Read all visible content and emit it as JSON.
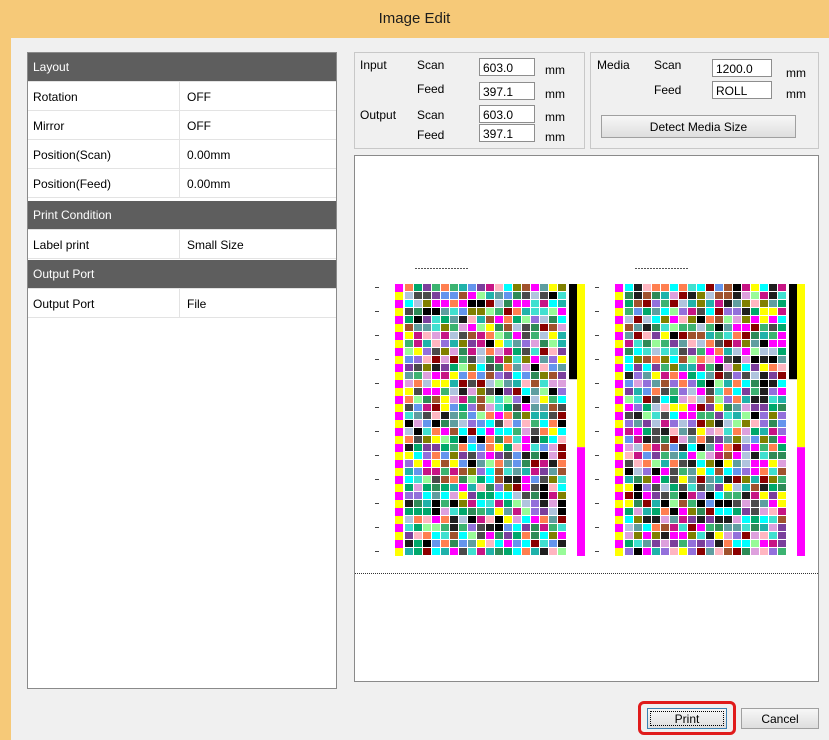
{
  "window": {
    "title": "Image Edit"
  },
  "properties": {
    "sections": [
      {
        "header": "Layout",
        "rows": [
          {
            "key": "Rotation",
            "value": "OFF"
          },
          {
            "key": "Mirror",
            "value": "OFF"
          },
          {
            "key": "Position(Scan)",
            "value": "0.00mm"
          },
          {
            "key": "Position(Feed)",
            "value": "0.00mm"
          }
        ]
      },
      {
        "header": "Print Condition",
        "rows": [
          {
            "key": "Label print",
            "value": "Small Size"
          }
        ]
      },
      {
        "header": "Output Port",
        "rows": [
          {
            "key": "Output Port",
            "value": "File"
          }
        ]
      }
    ]
  },
  "sizes": {
    "input_label": "Input",
    "output_label": "Output",
    "scan_label": "Scan",
    "feed_label": "Feed",
    "unit": "mm",
    "input_scan": "603.0",
    "input_feed": "397.1",
    "output_scan": "603.0",
    "output_feed": "397.1"
  },
  "media": {
    "label": "Media",
    "scan_label": "Scan",
    "feed_label": "Feed",
    "scan_value": "1200.0",
    "feed_value": "ROLL",
    "unit": "mm",
    "detect_button": "Detect Media Size"
  },
  "footer": {
    "print_button": "Print",
    "cancel_button": "Cancel"
  },
  "colors": {
    "title_bar": "#f6c978",
    "section_header": "#5e5e5e",
    "highlight": "#e01b1b",
    "patch_palette": [
      "#ff00ff",
      "#ffff00",
      "#00ffff",
      "#000000",
      "#1e1e1e",
      "#4a4a4a",
      "#7b3f9c",
      "#2e8b57",
      "#c71585",
      "#6495ed",
      "#00a86b",
      "#ff7f50",
      "#a0522d",
      "#b0c4de",
      "#98fb98",
      "#dda0dd",
      "#40e0d0",
      "#808000",
      "#5f9ea0",
      "#8b0000",
      "#ffb6c1",
      "#3cb371",
      "#9370db",
      "#20b2aa"
    ]
  }
}
